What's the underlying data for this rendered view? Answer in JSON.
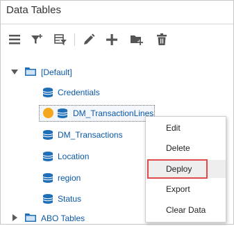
{
  "panel": {
    "title": "Data Tables"
  },
  "toolbar": {
    "icons": [
      "list-view-icon",
      "add-filter-icon",
      "filter-table-icon",
      "edit-icon",
      "add-icon",
      "add-folder-icon",
      "delete-icon"
    ]
  },
  "tree": {
    "root_label": "[Default]",
    "items": [
      {
        "label": "Credentials"
      },
      {
        "label": "DM_TransactionLines"
      },
      {
        "label": "DM_Transactions"
      },
      {
        "label": "Location"
      },
      {
        "label": "region"
      },
      {
        "label": "Status"
      }
    ],
    "second_folder_label": "ABO Tables"
  },
  "context_menu": {
    "items": [
      {
        "label": "Edit"
      },
      {
        "label": "Delete"
      },
      {
        "label": "Deploy"
      },
      {
        "label": "Export"
      },
      {
        "label": "Clear Data"
      }
    ],
    "highlighted": "Deploy"
  },
  "colors": {
    "link": "#0a57a5",
    "icon_blue": "#1f6fb8",
    "status_dot": "#f4a61d",
    "highlight": "#e04a4a"
  }
}
